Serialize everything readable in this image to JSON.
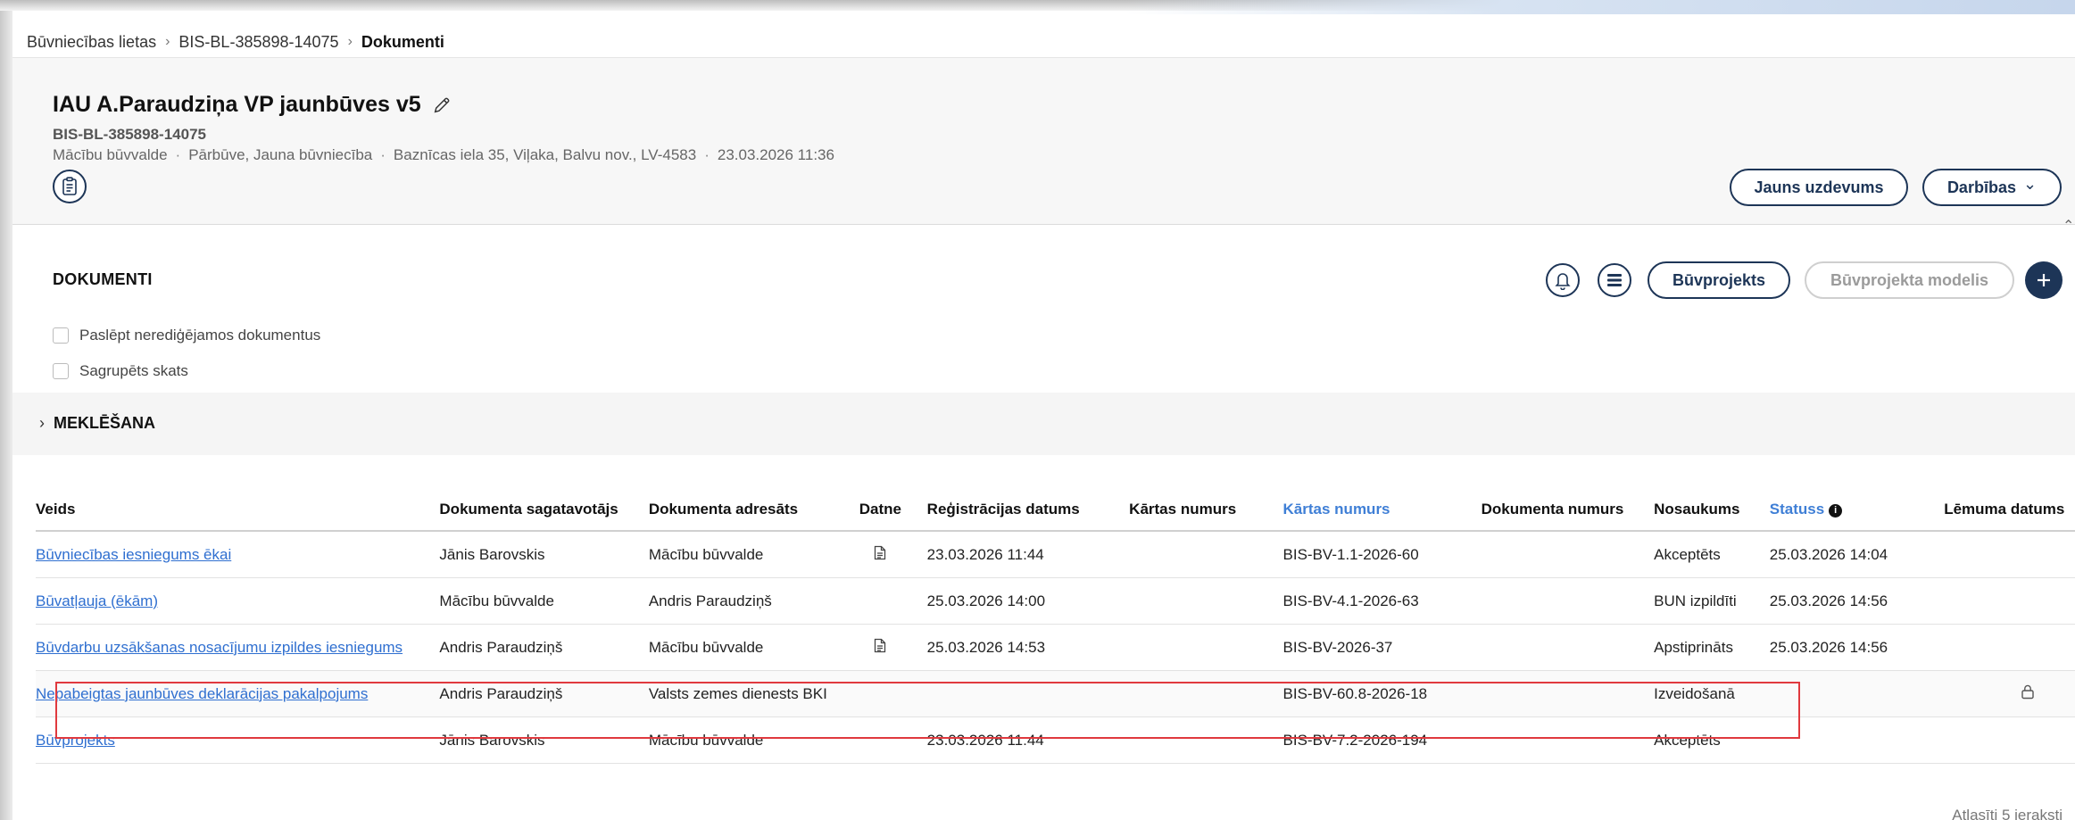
{
  "breadcrumb": {
    "items": [
      "Būvniecības lietas",
      "BIS-BL-385898-14075",
      "Dokumenti"
    ]
  },
  "header": {
    "title": "IAU A.Paraudziņa VP jaunbūves v5",
    "case_number": "BIS-BL-385898-14075",
    "meta": [
      "Mācību būvvalde",
      "Pārbūve, Jauna būvniecība",
      "Baznīcas iela 35, Viļaka, Balvu nov., LV-4583",
      "23.03.2026 11:36"
    ],
    "new_task_label": "Jauns uzdevums",
    "actions_label": "Darbības",
    "actions_chevron": "⌄"
  },
  "documents": {
    "section_title": "DOKUMENTI",
    "buvprojekts_label": "Būvprojekts",
    "buvprojekta_modelis_label": "Būvprojekta modelis",
    "hide_noneditable_label": "Paslēpt nerediģējamos dokumentus",
    "grouped_view_label": "Sagrupēts skats",
    "search_label": "MEKLĒŠANA",
    "search_chevron": "›",
    "columns": [
      "Veids",
      "Dokumenta sagatavotājs",
      "Dokumenta adresāts",
      "Datne",
      "Reģistrācijas datums",
      "Kārtas numurs",
      "Kārtas numurs",
      "Dokumenta numurs",
      "Nosaukums",
      "Statuss",
      "Lēmuma datums"
    ],
    "info_glyph": "i",
    "rows": [
      {
        "veids": "Būvniecības iesniegums ēkai",
        "sagatavotajs": "Jānis Barovskis",
        "adresats": "Mācību būvvalde",
        "datne": true,
        "reg_datums": "23.03.2026 11:44",
        "kartas1": "",
        "kartas2": "BIS-BV-1.1-2026-60",
        "dok_numurs": "",
        "nosaukums": "Akceptēts",
        "statuss": "25.03.2026 14:04",
        "lemuma": "",
        "locked": false
      },
      {
        "veids": "Būvatļauja (ēkām)",
        "sagatavotajs": "Mācību būvvalde",
        "adresats": "Andris Paraudziņš",
        "datne": false,
        "reg_datums": "25.03.2026 14:00",
        "kartas1": "",
        "kartas2": "BIS-BV-4.1-2026-63",
        "dok_numurs": "",
        "nosaukums": "BUN izpildīti",
        "statuss": "25.03.2026 14:56",
        "lemuma": "",
        "locked": false
      },
      {
        "veids": "Būvdarbu uzsākšanas nosacījumu izpildes iesniegums",
        "sagatavotajs": "Andris Paraudziņš",
        "adresats": "Mācību būvvalde",
        "datne": true,
        "reg_datums": "25.03.2026 14:53",
        "kartas1": "",
        "kartas2": "BIS-BV-2026-37",
        "dok_numurs": "",
        "nosaukums": "Apstiprināts",
        "statuss": "25.03.2026 14:56",
        "lemuma": "",
        "locked": false
      },
      {
        "veids": "Nepabeigtas jaunbūves deklarācijas pakalpojums",
        "sagatavotajs": "Andris Paraudziņš",
        "adresats": "Valsts zemes dienests BKI",
        "datne": false,
        "reg_datums": "",
        "kartas1": "",
        "kartas2": "BIS-BV-60.8-2026-18",
        "dok_numurs": "",
        "nosaukums": "Izveidošanā",
        "statuss": "",
        "lemuma": "",
        "locked": true
      },
      {
        "veids": "Būvprojekts",
        "sagatavotajs": "Jānis Barovskis",
        "adresats": "Mācību būvvalde",
        "datne": false,
        "reg_datums": "23.03.2026 11:44",
        "kartas1": "",
        "kartas2": "BIS-BV-7.2-2026-194",
        "dok_numurs": "",
        "nosaukums": "Akceptēts",
        "statuss": "",
        "lemuma": "",
        "locked": false
      }
    ],
    "footer_count": "Atlasīti 5 ieraksti"
  },
  "colors": {
    "primary": "#1d3557",
    "link": "#2f6fd0",
    "sortable_header": "#3f7fd6",
    "highlight": "#e0393e"
  },
  "icons": [
    "pencil-icon",
    "clipboard-icon",
    "bell-icon",
    "stack-icon",
    "plus-icon",
    "document-icon",
    "lock-icon",
    "info-icon"
  ]
}
